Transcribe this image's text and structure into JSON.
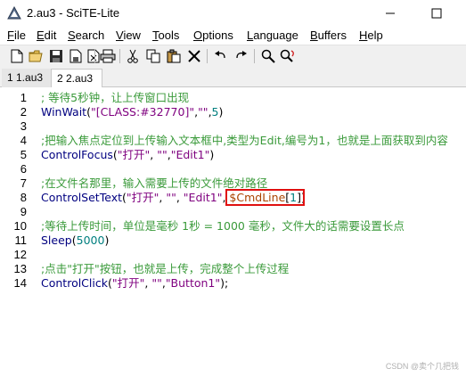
{
  "window": {
    "title": "2.au3 - SciTE-Lite"
  },
  "menu": {
    "items": [
      {
        "label": "File",
        "ul": "F",
        "rest": "ile"
      },
      {
        "label": "Edit",
        "ul": "E",
        "rest": "dit"
      },
      {
        "label": "Search",
        "ul": "S",
        "rest": "earch"
      },
      {
        "label": "View",
        "ul": "V",
        "rest": "iew"
      },
      {
        "label": "Tools",
        "ul": "T",
        "rest": "ools"
      },
      {
        "label": "Options",
        "ul": "O",
        "rest": "ptions"
      },
      {
        "label": "Language",
        "ul": "L",
        "rest": "anguage"
      },
      {
        "label": "Buffers",
        "ul": "B",
        "rest": "uffers"
      },
      {
        "label": "Help",
        "ul": "H",
        "rest": "elp"
      }
    ]
  },
  "toolbar": {
    "icons": [
      "new-file-icon",
      "open-folder-icon",
      "save-icon",
      "save-as-icon",
      "close-icon",
      "print-icon",
      "cut-icon",
      "copy-icon",
      "paste-icon",
      "delete-icon",
      "undo-icon",
      "redo-icon",
      "find-icon",
      "find-replace-icon"
    ]
  },
  "tabs": [
    {
      "label": "1 1.au3",
      "active": false
    },
    {
      "label": "2 2.au3",
      "active": true
    }
  ],
  "editor": {
    "line_numbers": [
      "1",
      "2",
      "3",
      "4",
      "5",
      "6",
      "7",
      "8",
      "9",
      "10",
      "11",
      "12",
      "13",
      "14"
    ],
    "lines": {
      "l1": "; 等待5秒钟，让上传窗口出现",
      "l2_func": "WinWait",
      "l2_open": "(",
      "l2_str": "\"[CLASS:#32770]\"",
      "l2_comma1": ",",
      "l2_str2": "\"\"",
      "l2_comma2": ",",
      "l2_num": "5",
      "l2_close": ")",
      "l4": ";把输入焦点定位到上传输入文本框中,类型为Edit,编号为1，也就是上面获取到内容",
      "l5_func": "ControlFocus",
      "l5_open": "(",
      "l5_str1": "\"打开\"",
      "l5_comma1": ", ",
      "l5_str2": "\"\"",
      "l5_comma2": ",",
      "l5_str3": "\"Edit1\"",
      "l5_close": ")",
      "l7": ";在文件名那里，输入需要上传的文件绝对路径",
      "l8_func": "ControlSetText",
      "l8_open": "(",
      "l8_str1": "\"打开\"",
      "l8_comma1": ", ",
      "l8_str2": "\"\"",
      "l8_comma2": ", ",
      "l8_str3": "\"Edit1\"",
      "l8_comma3": ", ",
      "l8_var": "$CmdLine",
      "l8_bopen": "[",
      "l8_num": "1",
      "l8_bclose": "]",
      "l8_close": ")",
      "l10": ";等待上传时间，单位是毫秒 1秒 = 1000 毫秒，文件大的话需要设置长点",
      "l11_func": "Sleep",
      "l11_open": "(",
      "l11_num": "5000",
      "l11_close": ")",
      "l13": ";点击\"打开\"按钮，也就是上传，完成整个上传过程",
      "l14_func": "ControlClick",
      "l14_open": "(",
      "l14_str1": "\"打开\"",
      "l14_comma1": ", ",
      "l14_str2": "\"\"",
      "l14_comma2": ",",
      "l14_str3": "\"Button1\"",
      "l14_close": ");"
    }
  },
  "watermark": "CSDN @卖个几把钱",
  "colors": {
    "comment": "#3a9a3a",
    "function": "#000080",
    "string": "#7f007f",
    "number": "#007f7f",
    "highlight_border": "#e01010"
  }
}
